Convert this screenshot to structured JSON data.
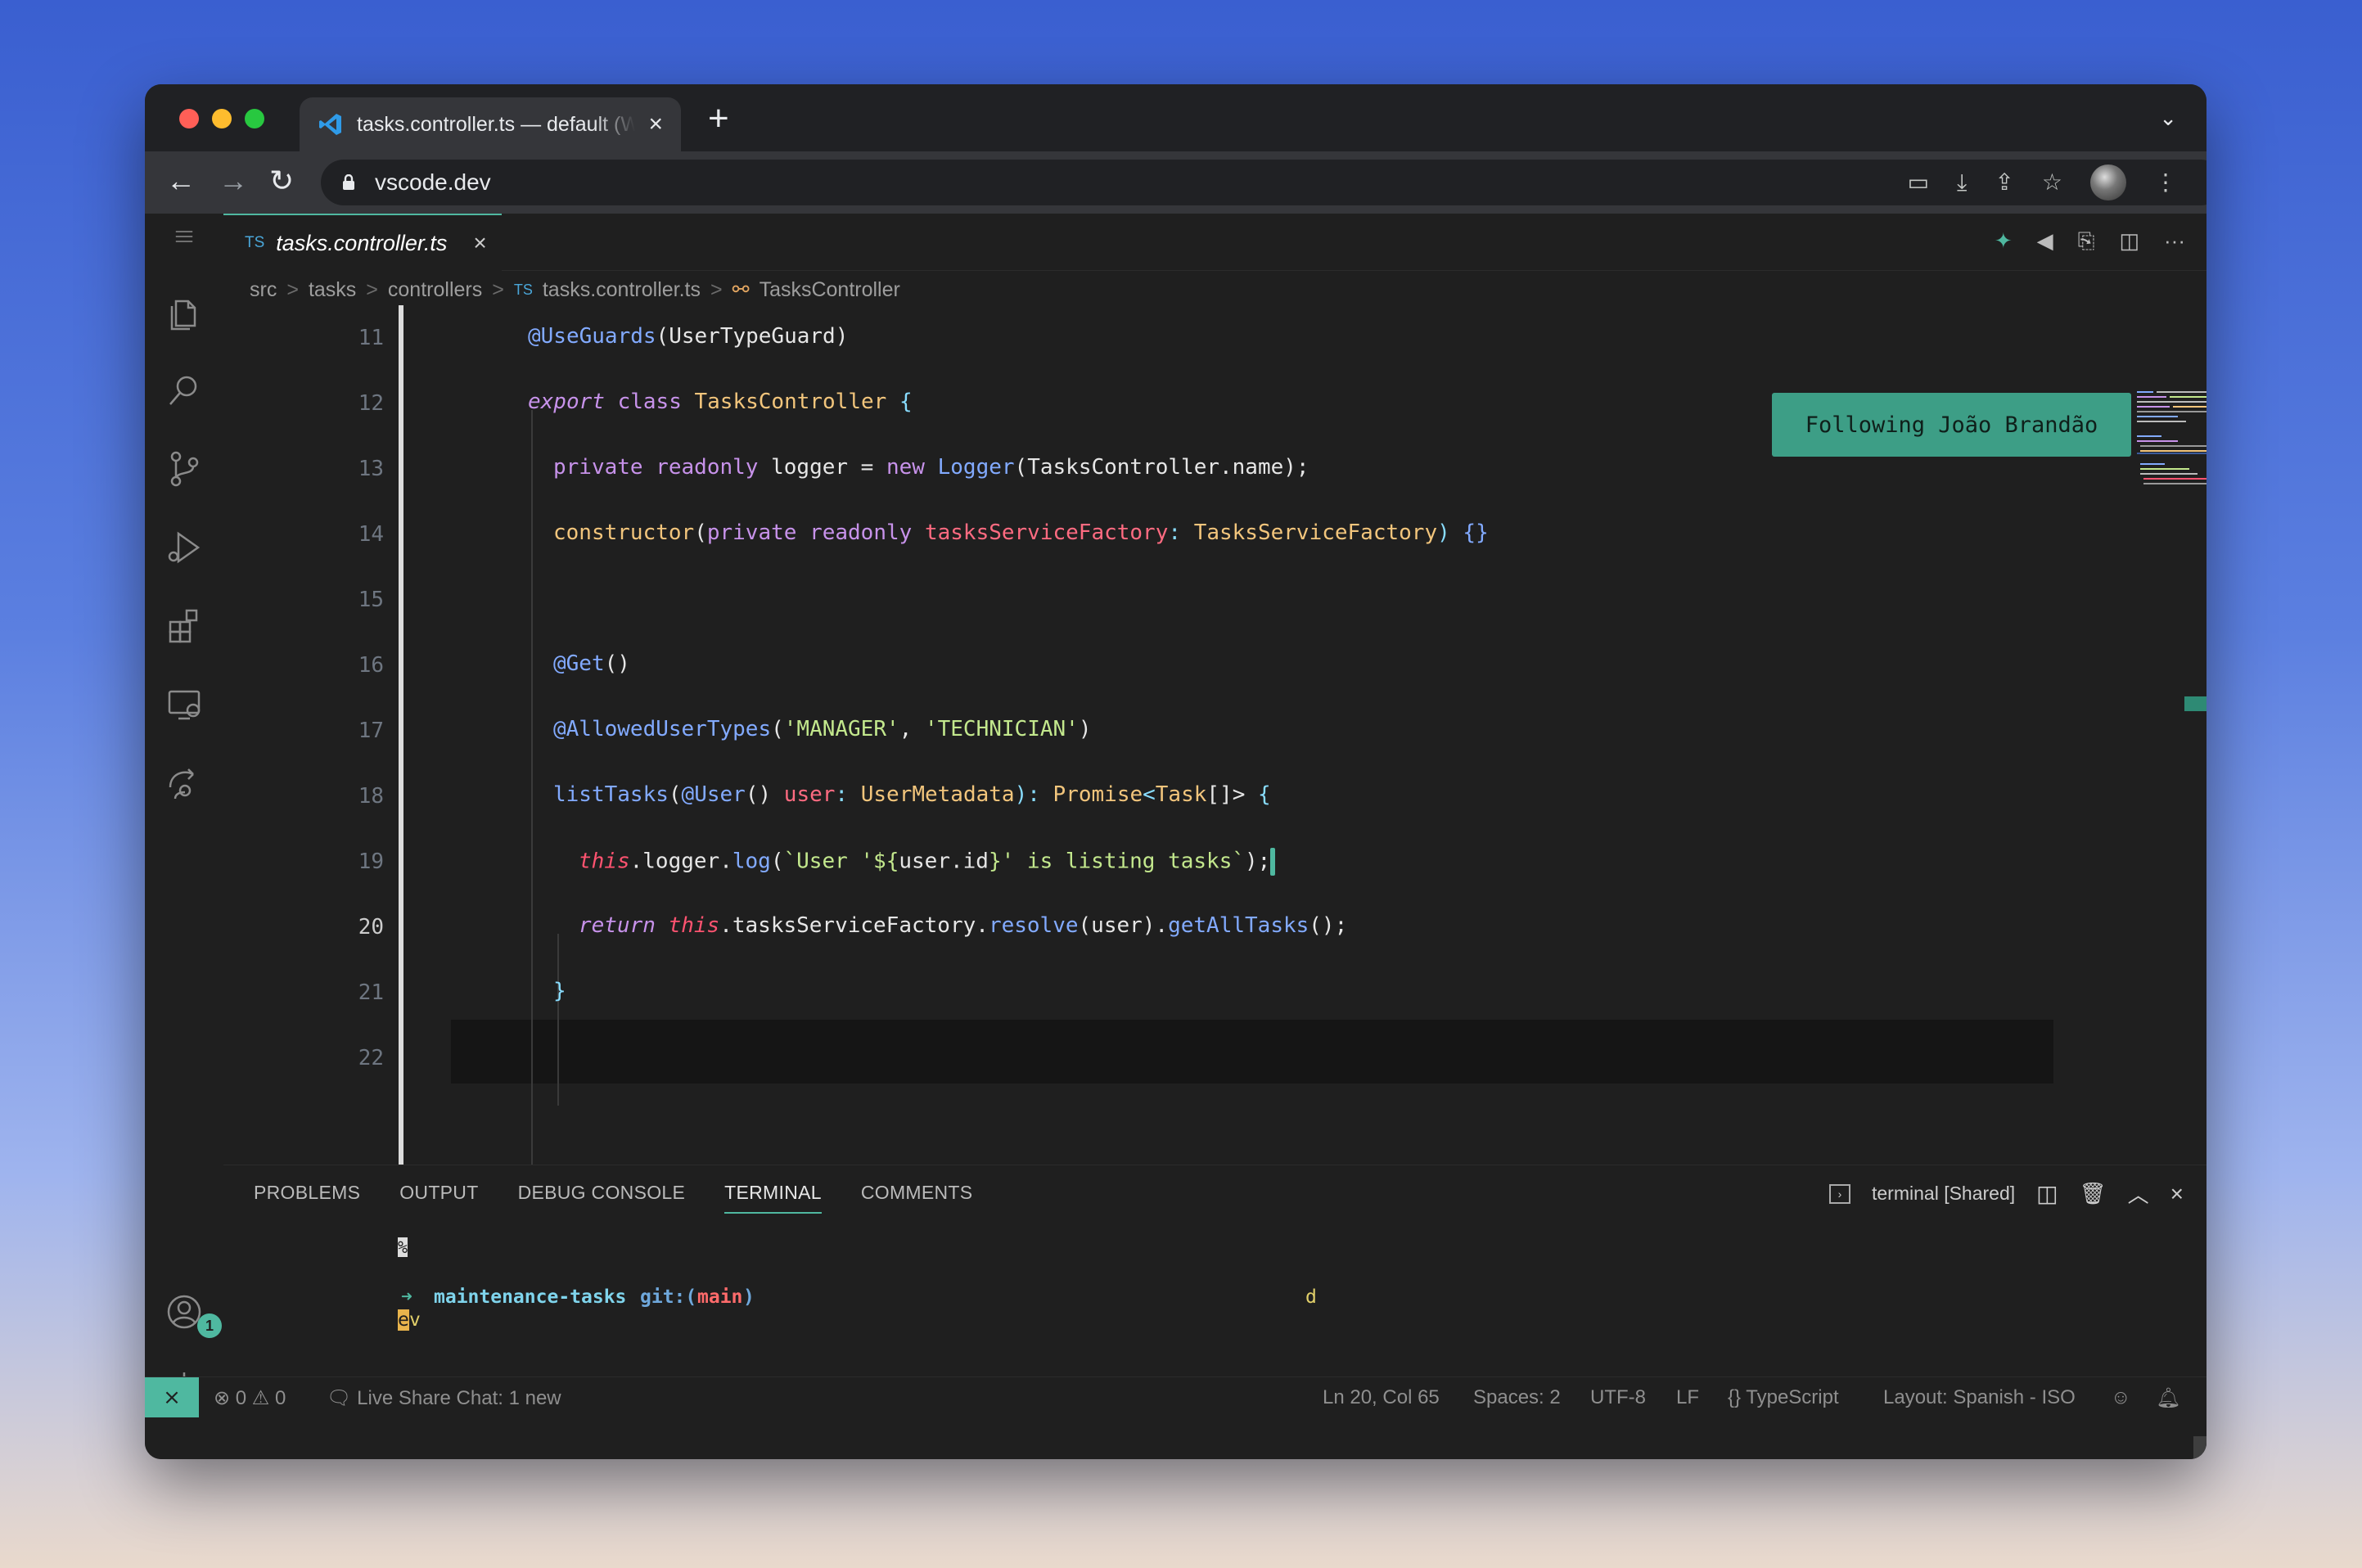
{
  "browser": {
    "tab_title": "tasks.controller.ts — default (Workspace)",
    "tab_close": "×",
    "new_tab": "+",
    "tab_menu": "⌄",
    "url": "vscode.dev",
    "back": "←",
    "forward": "→",
    "reload": "↻",
    "toolbar_icons": [
      "clipboard-icon",
      "install-icon",
      "share-icon",
      "bookmark-star-icon"
    ],
    "menu": "⋮"
  },
  "editor": {
    "tab": {
      "lang": "TS",
      "name": "tasks.controller.ts",
      "close": "×"
    },
    "actions": [
      "pin-icon",
      "broadcast-icon",
      "live-share-icon",
      "split-editor-icon",
      "more-icon"
    ],
    "action_glyphs": [
      "✦",
      "◀",
      "⎘",
      "◫",
      "···"
    ],
    "breadcrumbs": [
      "src",
      "tasks",
      "controllers",
      "TS",
      "tasks.controller.ts",
      "TasksController"
    ],
    "breadcrumb_sep": ">",
    "line_numbers": [
      "11",
      "12",
      "13",
      "14",
      "15",
      "16",
      "17",
      "18",
      "19",
      "20",
      "21",
      "22"
    ],
    "current_line": "20",
    "follow_banner": "Following João Brandão"
  },
  "code": {
    "l11": [
      "@UseGuards",
      "(UserTypeGuard)"
    ],
    "l12": [
      "export",
      " class ",
      "TasksController",
      " {"
    ],
    "l13": [
      "private readonly",
      " logger = ",
      "new",
      " ",
      "Logger",
      "(TasksController.name);"
    ],
    "l14": [
      "constructor",
      "(",
      "private readonly",
      " ",
      "tasksServiceFactory",
      ": ",
      "TasksServiceFactory",
      ") ",
      "{}"
    ],
    "l16": [
      "@Get",
      "()"
    ],
    "l17": [
      "@AllowedUserTypes",
      "(",
      "'MANAGER'",
      ", ",
      "'TECHNICIAN'",
      ")"
    ],
    "l18": [
      "listTasks",
      "(",
      "@User",
      "() ",
      "user",
      ": ",
      "UserMetadata",
      "): ",
      "Promise",
      "<",
      "Task",
      "[]> ",
      "{"
    ],
    "l19": [
      "this",
      ".logger.",
      "log",
      "(",
      "`User '${",
      "user.id",
      "}' is listing tasks`",
      ");"
    ],
    "l20": [
      "return",
      " ",
      "this",
      ".tasksServiceFactory.",
      "resolve",
      "(user).",
      "getAllTasks",
      "();"
    ],
    "l21": [
      "}"
    ]
  },
  "panel": {
    "tabs": [
      "PROBLEMS",
      "OUTPUT",
      "DEBUG CONSOLE",
      "TERMINAL",
      "COMMENTS"
    ],
    "active_tab": "TERMINAL",
    "terminal_name": "terminal [Shared]",
    "terminal": {
      "line1": "%",
      "arrow": "➜",
      "dir": "maintenance-tasks",
      "git": "git:(",
      "branch": "main",
      "git_close": ")",
      "remote_char": "d",
      "cursor_char": "e",
      "typed": "v"
    }
  },
  "activity_bar": {
    "items": [
      "explorer-icon",
      "search-icon",
      "source-control-icon",
      "run-debug-icon",
      "extensions-icon",
      "remote-explorer-icon",
      "live-share-icon"
    ],
    "accounts_badge": "1"
  },
  "status_bar": {
    "remote": "⨯",
    "errors": "0",
    "warnings": "0",
    "live_share_chat": "Live Share Chat: 1 new",
    "position": "Ln 20, Col 65",
    "spaces": "Spaces: 2",
    "encoding": "UTF-8",
    "eol": "LF",
    "language": "TypeScript",
    "layout": "Layout: Spanish - ISO"
  },
  "colors": {
    "accent": "#4fb8a0",
    "keyword": "#c792ea",
    "class": "#f2c57c",
    "function": "#82aaff",
    "string": "#c3e88d",
    "parameter": "#ff6b81"
  }
}
